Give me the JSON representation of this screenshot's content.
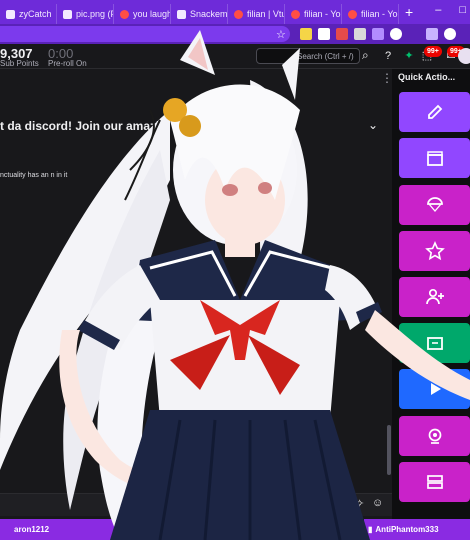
{
  "browser": {
    "tabs": [
      {
        "label": "zyCatch"
      },
      {
        "label": "pic.png (PNG I..."
      },
      {
        "label": "you laugh..."
      },
      {
        "label": "SnackemH..."
      },
      {
        "label": "filian | Vtu..."
      },
      {
        "label": "filian - You..."
      },
      {
        "label": "filian - You..."
      }
    ],
    "new_tab": "+",
    "minimize": "–",
    "maximize": "□"
  },
  "twitch": {
    "points_value": "9,307",
    "points_label": "Sub Points",
    "preroll_value": "0:00",
    "preroll_label": "Pre-roll On",
    "search_placeholder": "Search (Ctrl + /)",
    "badges": [
      "99+",
      "99+"
    ],
    "quick_actions_title": "Quick Actio...",
    "panel_title": "t da discord! Join our amazin",
    "panel_text": "nctuality has an n in it",
    "quick_actions": [
      {
        "icon": "pencil-icon",
        "color": "#9147ff"
      },
      {
        "icon": "clapper-icon",
        "color": "#9147ff"
      },
      {
        "icon": "parachute-icon",
        "color": "#c922c9"
      },
      {
        "icon": "star-icon",
        "color": "#c922c9"
      },
      {
        "icon": "add-user-icon",
        "color": "#c922c9"
      },
      {
        "icon": "ad-icon",
        "color": "#00a86b"
      },
      {
        "icon": "play-icon",
        "color": "#1f69ff"
      },
      {
        "icon": "webcam-icon",
        "color": "#c922c9"
      },
      {
        "icon": "layers-icon",
        "color": "#c922c9"
      }
    ],
    "bottom_bar": [
      {
        "user": "aron1212"
      },
      {
        "user": "AntiPhantom333"
      }
    ]
  }
}
